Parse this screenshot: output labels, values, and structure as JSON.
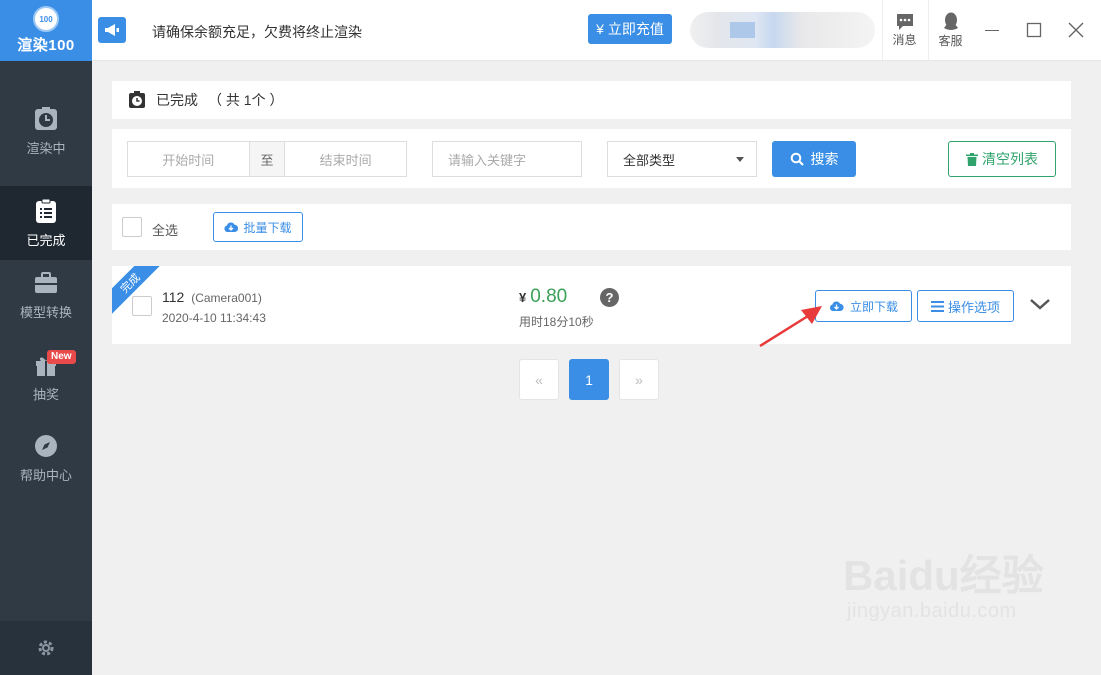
{
  "app": {
    "logo_badge": "100",
    "logo_text": "渲染100"
  },
  "sidebar": {
    "items": [
      {
        "label": "渲染中",
        "icon": "clock-icon"
      },
      {
        "label": "已完成",
        "icon": "list-icon"
      },
      {
        "label": "模型转换",
        "icon": "briefcase-icon"
      },
      {
        "label": "抽奖",
        "icon": "gift-icon",
        "badge": "New"
      },
      {
        "label": "帮助中心",
        "icon": "compass-icon"
      }
    ],
    "active_index": 1
  },
  "topbar": {
    "notice": "请确保余额充足，欠费将终止渲染",
    "recharge_label": "¥ 立即充值",
    "messages_label": "消息",
    "service_label": "客服"
  },
  "title_bar": {
    "title": "已完成",
    "count_text": "（ 共 1个 ）"
  },
  "filters": {
    "start_placeholder": "开始时间",
    "to_label": "至",
    "end_placeholder": "结束时间",
    "keyword_placeholder": "请输入关键字",
    "type_selected": "全部类型",
    "search_label": "搜索",
    "clear_label": "清空列表"
  },
  "select_bar": {
    "select_all_label": "全选",
    "batch_download_label": "批量下载"
  },
  "tasks": [
    {
      "status": "完成",
      "name": "112",
      "camera": "(Camera001)",
      "date": "2020-4-10 11:34:43",
      "currency": "¥",
      "price": "0.80",
      "duration": "用时18分10秒",
      "download_label": "立即下载",
      "ops_label": "操作选项"
    }
  ],
  "pagination": {
    "prev": "«",
    "current": "1",
    "next": "»"
  },
  "watermark": {
    "line1": "Baidu经验",
    "line2": "jingyan.baidu.com"
  },
  "colors": {
    "accent": "#3a8ee6",
    "sidebar": "#2f3a45",
    "green": "#2fa36b",
    "price_green": "#3aa157",
    "arrow_red": "#e83a3a"
  }
}
